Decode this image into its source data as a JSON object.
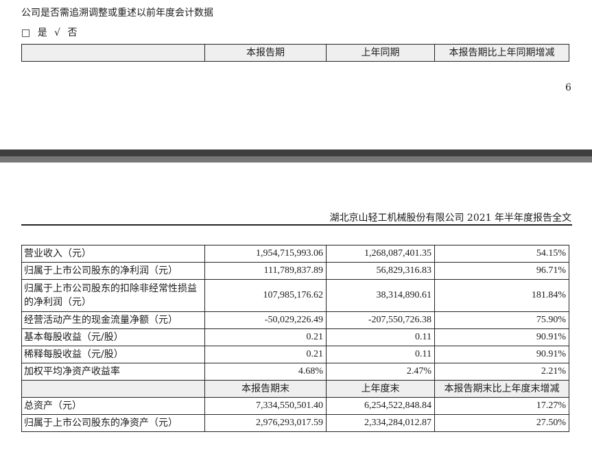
{
  "page_top": {
    "question": "公司是否需追溯调整或重述以前年度会计数据",
    "option_yes_box": "□",
    "option_yes": "是",
    "option_no_mark": "√",
    "option_no": "否",
    "header": {
      "col0": "",
      "col1": "本报告期",
      "col2": "上年同期",
      "col3": "本报告期比上年同期增减"
    },
    "page_number": "6"
  },
  "page_bottom": {
    "running_header": "湖北京山轻工机械股份有限公司 2021 年半年度报告全文"
  },
  "table": {
    "rows": [
      {
        "label": "营业收入（元）",
        "current": "1,954,715,993.06",
        "prior": "1,268,087,401.35",
        "change": "54.15%"
      },
      {
        "label": "归属于上市公司股东的净利润（元）",
        "current": "111,789,837.89",
        "prior": "56,829,316.83",
        "change": "96.71%"
      },
      {
        "label": "归属于上市公司股东的扣除非经常性损益的净利润（元）",
        "current": "107,985,176.62",
        "prior": "38,314,890.61",
        "change": "181.84%"
      },
      {
        "label": "经营活动产生的现金流量净额（元）",
        "current": "-50,029,226.49",
        "prior": "-207,550,726.38",
        "change": "75.90%"
      },
      {
        "label": "基本每股收益（元/股）",
        "current": "0.21",
        "prior": "0.11",
        "change": "90.91%"
      },
      {
        "label": "稀释每股收益（元/股）",
        "current": "0.21",
        "prior": "0.11",
        "change": "90.91%"
      },
      {
        "label": "加权平均净资产收益率",
        "current": "4.68%",
        "prior": "2.47%",
        "change": "2.21%"
      }
    ],
    "header2": {
      "col0": "",
      "col1": "本报告期末",
      "col2": "上年度末",
      "col3": "本报告期末比上年度末增减"
    },
    "rows2": [
      {
        "label": "总资产（元）",
        "current": "7,334,550,501.40",
        "prior": "6,254,522,848.84",
        "change": "17.27%"
      },
      {
        "label": "归属于上市公司股东的净资产（元）",
        "current": "2,976,293,017.59",
        "prior": "2,334,284,012.87",
        "change": "27.50%"
      }
    ]
  }
}
